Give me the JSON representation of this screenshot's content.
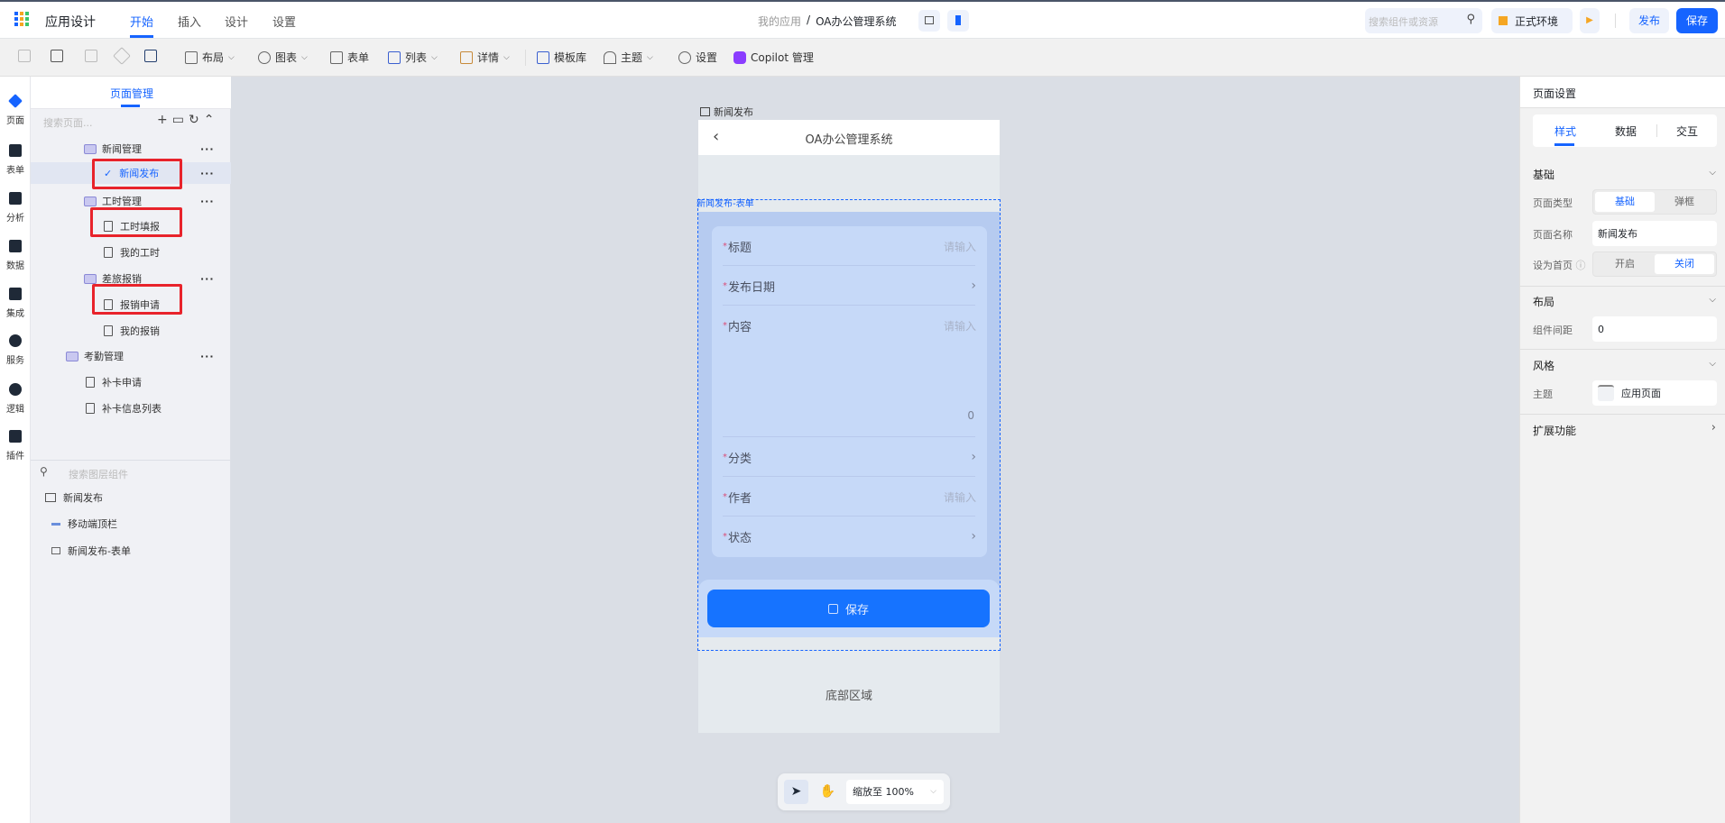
{
  "topbar": {
    "app_title": "应用设计",
    "tabs": [
      "开始",
      "插入",
      "设计",
      "设置"
    ],
    "breadcrumb_parent": "我的应用",
    "breadcrumb_sep": "/",
    "breadcrumb_current": "OA办公管理系统",
    "search_placeholder": "搜索组件或资源",
    "env_label": "正式环境",
    "publish_label": "发布",
    "save_label": "保存"
  },
  "toolbar": {
    "layout": "布局",
    "chart": "图表",
    "form": "表单",
    "list": "列表",
    "detail": "详情",
    "templates": "模板库",
    "theme": "主题",
    "settings": "设置",
    "copilot": "Copilot 管理"
  },
  "rail": [
    "页面",
    "表单",
    "分析",
    "数据",
    "集成",
    "服务",
    "逻辑",
    "插件"
  ],
  "sidebar": {
    "tab": "页面管理",
    "search_placeholder": "搜索页面...",
    "tree": [
      {
        "label": "新闻管理",
        "type": "folder"
      },
      {
        "label": "新闻发布",
        "type": "page",
        "selected": true
      },
      {
        "label": "工时管理",
        "type": "folder"
      },
      {
        "label": "工时填报",
        "type": "page"
      },
      {
        "label": "我的工时",
        "type": "page"
      },
      {
        "label": "差旅报销",
        "type": "folder"
      },
      {
        "label": "报销申请",
        "type": "page"
      },
      {
        "label": "我的报销",
        "type": "page"
      },
      {
        "label": "考勤管理",
        "type": "folder"
      },
      {
        "label": "补卡申请",
        "type": "page"
      },
      {
        "label": "补卡信息列表",
        "type": "page"
      }
    ],
    "layer_search_placeholder": "搜索图层组件",
    "layers": [
      "新闻发布",
      "移动端顶栏",
      "新闻发布-表单"
    ]
  },
  "canvas": {
    "page_label": "新闻发布",
    "header_title": "OA办公管理系统",
    "form_label": "新闻发布-表单",
    "fields": [
      {
        "label": "标题",
        "placeholder": "请输入"
      },
      {
        "label": "发布日期"
      },
      {
        "label": "内容",
        "placeholder": "请输入",
        "count": "0"
      },
      {
        "label": "分类"
      },
      {
        "label": "作者",
        "placeholder": "请输入"
      },
      {
        "label": "状态"
      }
    ],
    "required_mark": "*",
    "save_button": "保存",
    "footer": "底部区域",
    "zoom": "缩放至 100%"
  },
  "rightpanel": {
    "title": "页面设置",
    "tabs": [
      "样式",
      "数据",
      "交互"
    ],
    "basic": "基础",
    "page_type_label": "页面类型",
    "page_type_options": [
      "基础",
      "弹框"
    ],
    "page_name_label": "页面名称",
    "page_name": "新闻发布",
    "homepage_label": "设为首页",
    "homepage_options": [
      "开启",
      "关闭"
    ],
    "layout": "布局",
    "spacing_label": "组件间距",
    "spacing": "0",
    "style": "风格",
    "theme_label": "主题",
    "theme": "应用页面",
    "extensions": "扩展功能"
  },
  "colors": {
    "accent": "#1664ff",
    "highlight": "#e8232b"
  }
}
